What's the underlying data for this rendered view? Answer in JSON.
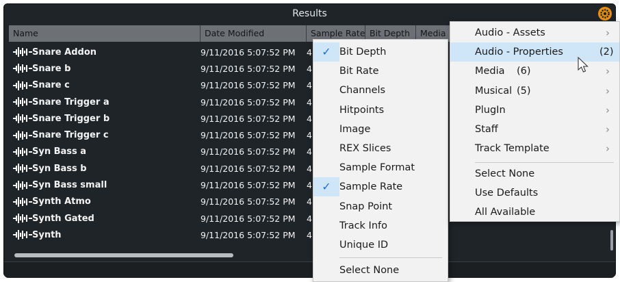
{
  "window": {
    "title": "Results"
  },
  "columns": [
    "Name",
    "Date Modified",
    "Sample Rate",
    "Bit Depth",
    "Media"
  ],
  "rows": [
    {
      "name": "Snare Addon",
      "date": "9/11/2016 5:07:52 PM",
      "rest": "4"
    },
    {
      "name": "Snare b",
      "date": "9/11/2016 5:07:52 PM",
      "rest": "4"
    },
    {
      "name": "Snare c",
      "date": "9/11/2016 5:07:52 PM",
      "rest": "4"
    },
    {
      "name": "Snare Trigger a",
      "date": "9/11/2016 5:07:52 PM",
      "rest": "4"
    },
    {
      "name": "Snare Trigger b",
      "date": "9/11/2016 5:07:52 PM",
      "rest": "4"
    },
    {
      "name": "Snare Trigger c",
      "date": "9/11/2016 5:07:52 PM",
      "rest": "4"
    },
    {
      "name": "Syn Bass a",
      "date": "9/11/2016 5:07:52 PM",
      "rest": "4"
    },
    {
      "name": "Syn Bass b",
      "date": "9/11/2016 5:07:52 PM",
      "rest": "4"
    },
    {
      "name": "Syn Bass small",
      "date": "9/11/2016 5:07:52 PM",
      "rest": "4"
    },
    {
      "name": "Synth Atmo",
      "date": "9/11/2016 5:07:52 PM",
      "rest": "4"
    },
    {
      "name": "Synth Gated",
      "date": "9/11/2016 5:07:52 PM",
      "rest": "4"
    },
    {
      "name": "Synth",
      "date": "9/11/2016 5:07:52 PM",
      "rest": "4"
    }
  ],
  "properties_menu": [
    {
      "label": "Bit Depth",
      "checked": true
    },
    {
      "label": "Bit Rate",
      "checked": false
    },
    {
      "label": "Channels",
      "checked": false
    },
    {
      "label": "Hitpoints",
      "checked": false
    },
    {
      "label": "Image",
      "checked": false
    },
    {
      "label": "REX Slices",
      "checked": false
    },
    {
      "label": "Sample Format",
      "checked": false
    },
    {
      "label": "Sample Rate",
      "checked": true
    },
    {
      "label": "Snap Point",
      "checked": false
    },
    {
      "label": "Track Info",
      "checked": false
    },
    {
      "label": "Unique ID",
      "checked": false
    }
  ],
  "properties_menu_footer": "Select None",
  "category_menu": [
    {
      "label": "Audio - Assets",
      "count": "",
      "submenu": true
    },
    {
      "label": "Audio - Properties",
      "count": "(2)",
      "submenu": true
    },
    {
      "label": "Media",
      "count": "(6)",
      "submenu": true
    },
    {
      "label": "Musical",
      "count": "(5)",
      "submenu": true
    },
    {
      "label": "PlugIn",
      "count": "",
      "submenu": true
    },
    {
      "label": "Staff",
      "count": "",
      "submenu": true
    },
    {
      "label": "Track Template",
      "count": "",
      "submenu": true
    }
  ],
  "category_menu_footer": [
    "Select None",
    "Use Defaults",
    "All Available"
  ],
  "colors": {
    "accent": "#e8900c",
    "highlight": "#cfe5f8",
    "check": "#1e6fd0"
  },
  "icons": {
    "settings": "gear-icon",
    "row": "waveform-icon",
    "submenu": "chevron-right-icon",
    "check": "checkmark-icon",
    "pointer": "mouse-pointer-icon"
  }
}
